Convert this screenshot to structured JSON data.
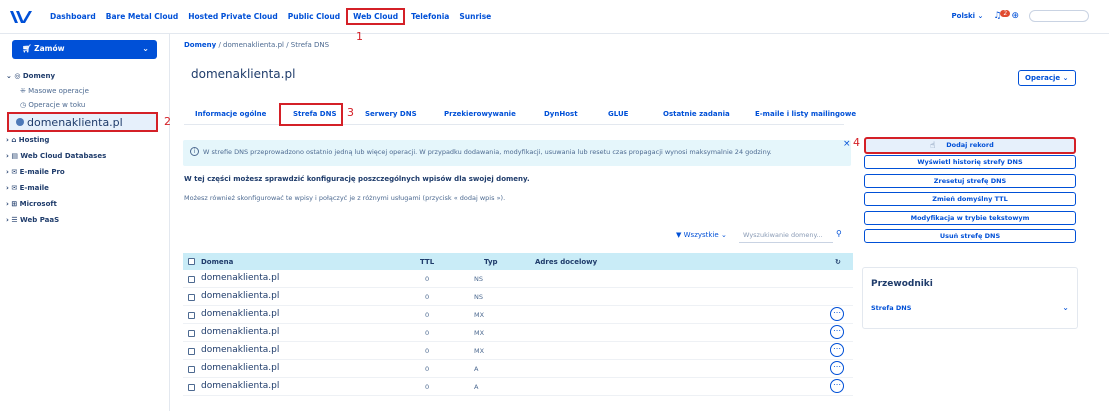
{
  "topnav": {
    "items": [
      "Dashboard",
      "Bare Metal Cloud",
      "Hosted Private Cloud",
      "Public Cloud",
      "Web Cloud",
      "Telefonia",
      "Sunrise"
    ],
    "language": "Polski",
    "notifications": "2"
  },
  "sidebar": {
    "order_label": "Zamów",
    "domains_label": "Domeny",
    "bulk_label": "Masowe operacje",
    "ongoing_label": "Operacje w toku",
    "selected_domain": "domenaklienta.pl",
    "items": [
      "Hosting",
      "Web Cloud Databases",
      "E-maile Pro",
      "E-maile",
      "Microsoft",
      "Web PaaS"
    ]
  },
  "annotations": [
    "1",
    "2",
    "3",
    "4"
  ],
  "breadcrumb": {
    "root": "Domeny",
    "domain": "domenaklienta.pl",
    "page": "Strefa DNS",
    "sep": "/"
  },
  "page": {
    "title": "domenaklienta.pl",
    "operations_label": "Operacje"
  },
  "tabs": [
    "Informacje ogólne",
    "Strefa DNS",
    "Serwery DNS",
    "Przekierowywanie",
    "DynHost",
    "GLUE",
    "Ostatnie zadania",
    "E-maile i listy mailingowe"
  ],
  "info_text": "W strefie DNS przeprowadzono ostatnio jedną lub więcej operacji. W przypadku dodawania, modyfikacji, usuwania lub resetu czas propagacji wynosi maksymalnie 24 godziny.",
  "desc": {
    "line1": "W tej części możesz sprawdzić konfigurację poszczególnych wpisów dla swojej domeny.",
    "line2": "Możesz również skonfigurować te wpisy i połączyć je z różnymi usługami (przycisk « dodaj wpis »)."
  },
  "table": {
    "filter_label": "Wszystkie",
    "search_placeholder": "Wyszukiwanie domeny...",
    "headers": [
      "Domena",
      "TTL",
      "Typ",
      "Adres docelowy"
    ],
    "rows": [
      {
        "domain": "domenaklienta.pl",
        "ttl": "0",
        "type": "NS"
      },
      {
        "domain": "domenaklienta.pl",
        "ttl": "0",
        "type": "NS"
      },
      {
        "domain": "domenaklienta.pl",
        "ttl": "0",
        "type": "MX"
      },
      {
        "domain": "domenaklienta.pl",
        "ttl": "0",
        "type": "MX"
      },
      {
        "domain": "domenaklienta.pl",
        "ttl": "0",
        "type": "MX"
      },
      {
        "domain": "domenaklienta.pl",
        "ttl": "0",
        "type": "A"
      },
      {
        "domain": "domenaklienta.pl",
        "ttl": "0",
        "type": "A"
      }
    ]
  },
  "actions": [
    "Dodaj rekord",
    "Wyświetl historię strefy DNS",
    "Zresetuj strefę DNS",
    "Zmień domyślny TTL",
    "Modyfikacja w trybie tekstowym",
    "Usuń strefę DNS"
  ],
  "guides": {
    "title": "Przewodniki",
    "item": "Strefa DNS"
  },
  "colors": {
    "accent": "#0050d7",
    "highlight": "#d42027",
    "info_bg": "#e5f6fb",
    "table_head": "#c9ecf7"
  }
}
